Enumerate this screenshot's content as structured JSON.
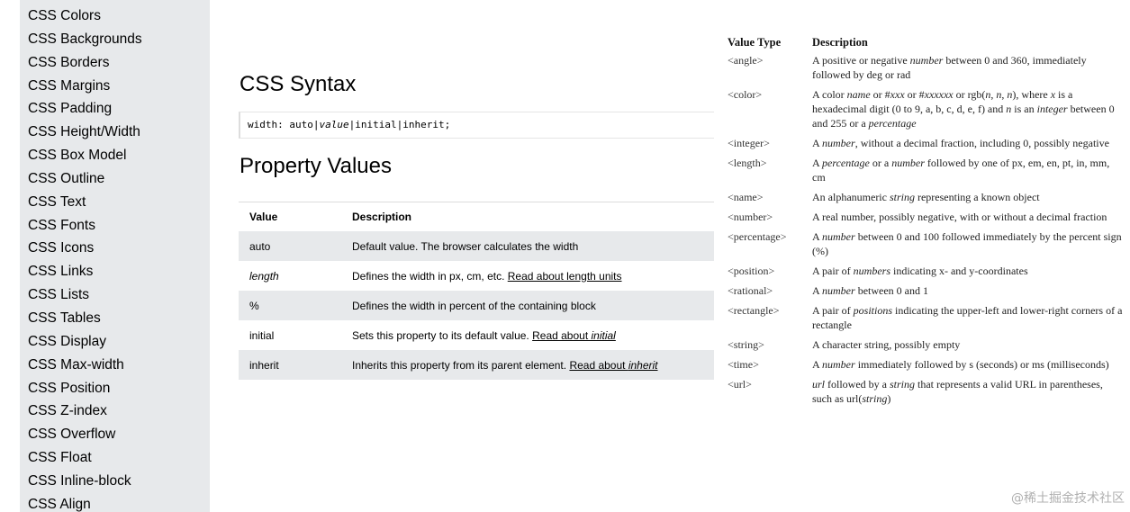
{
  "sidebar": {
    "items": [
      "CSS Colors",
      "CSS Backgrounds",
      "CSS Borders",
      "CSS Margins",
      "CSS Padding",
      "CSS Height/Width",
      "CSS Box Model",
      "CSS Outline",
      "CSS Text",
      "CSS Fonts",
      "CSS Icons",
      "CSS Links",
      "CSS Lists",
      "CSS Tables",
      "CSS Display",
      "CSS Max-width",
      "CSS Position",
      "CSS Z-index",
      "CSS Overflow",
      "CSS Float",
      "CSS Inline-block",
      "CSS Align"
    ]
  },
  "main": {
    "syntax_title": "CSS Syntax",
    "code": {
      "prefix": "width: auto|",
      "value": "value",
      "suffix": "|initial|inherit;"
    },
    "props_title": "Property Values",
    "table": {
      "headers": [
        "Value",
        "Description"
      ],
      "rows": [
        {
          "value": "auto",
          "desc": "Default value. The browser calculates the width",
          "link": "",
          "link_italic": ""
        },
        {
          "value": "length",
          "desc": "Defines the width in px, cm, etc. ",
          "link": "Read about length units",
          "link_italic": ""
        },
        {
          "value": "%",
          "desc": "Defines the width in percent of the containing block",
          "link": "",
          "link_italic": ""
        },
        {
          "value": "initial",
          "desc": "Sets this property to its default value. ",
          "link": "Read about ",
          "link_italic": "initial"
        },
        {
          "value": "inherit",
          "desc": "Inherits this property from its parent element. ",
          "link": "Read about ",
          "link_italic": "inherit"
        }
      ]
    }
  },
  "types": {
    "headers": [
      "Value Type",
      "Description"
    ],
    "rows": [
      {
        "type": "<angle>",
        "desc_html": "A positive or negative <i>number</i> between 0 and 360, immediately followed by deg or rad"
      },
      {
        "type": "<color>",
        "desc_html": "A color <i>name</i> or #<i>xxx</i> or #<i>xxxxxx</i> or rgb(<i>n</i>, <i>n</i>, <i>n</i>), where <i>x</i> is a hexadecimal digit (0 to 9, a, b, c, d, e, f) and <i>n</i> is an <i>integer</i> between 0 and 255 or a <i>percentage</i>"
      },
      {
        "type": "<integer>",
        "desc_html": "A <i>number</i>, without a decimal fraction, including 0, possibly negative"
      },
      {
        "type": "<length>",
        "desc_html": "A <i>percentage</i> or a <i>number</i> followed by one of px, em, en, pt, in, mm, cm"
      },
      {
        "type": "<name>",
        "desc_html": "An alphanumeric <i>string</i> representing a known object"
      },
      {
        "type": "<number>",
        "desc_html": "A real number, possibly negative, with or without a decimal fraction"
      },
      {
        "type": "<percentage>",
        "desc_html": "A <i>number</i> between 0 and 100 followed immediately by the percent sign (%)"
      },
      {
        "type": "<position>",
        "desc_html": "A pair of <i>numbers</i> indicating x- and y-coordinates"
      },
      {
        "type": "<rational>",
        "desc_html": "A <i>number</i> between 0 and 1"
      },
      {
        "type": "<rectangle>",
        "desc_html": "A pair of <i>positions</i> indicating the upper-left and lower-right corners of a rectangle"
      },
      {
        "type": "<string>",
        "desc_html": "A character string, possibly empty"
      },
      {
        "type": "<time>",
        "desc_html": "A <i>number</i> immediately followed by s (seconds) or ms (milliseconds)"
      },
      {
        "type": "<url>",
        "desc_html": "<i>url</i> followed by a <i>string</i> that represents a valid URL in parentheses, such as url(<i>string</i>)"
      }
    ]
  },
  "watermark": "@稀土掘金技术社区"
}
